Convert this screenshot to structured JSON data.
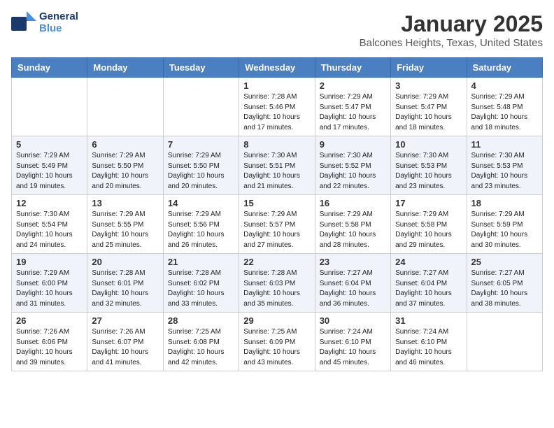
{
  "header": {
    "logo_general": "General",
    "logo_blue": "Blue",
    "month": "January 2025",
    "location": "Balcones Heights, Texas, United States"
  },
  "days_of_week": [
    "Sunday",
    "Monday",
    "Tuesday",
    "Wednesday",
    "Thursday",
    "Friday",
    "Saturday"
  ],
  "weeks": [
    [
      {
        "day": "",
        "info": ""
      },
      {
        "day": "",
        "info": ""
      },
      {
        "day": "",
        "info": ""
      },
      {
        "day": "1",
        "info": "Sunrise: 7:28 AM\nSunset: 5:46 PM\nDaylight: 10 hours\nand 17 minutes."
      },
      {
        "day": "2",
        "info": "Sunrise: 7:29 AM\nSunset: 5:47 PM\nDaylight: 10 hours\nand 17 minutes."
      },
      {
        "day": "3",
        "info": "Sunrise: 7:29 AM\nSunset: 5:47 PM\nDaylight: 10 hours\nand 18 minutes."
      },
      {
        "day": "4",
        "info": "Sunrise: 7:29 AM\nSunset: 5:48 PM\nDaylight: 10 hours\nand 18 minutes."
      }
    ],
    [
      {
        "day": "5",
        "info": "Sunrise: 7:29 AM\nSunset: 5:49 PM\nDaylight: 10 hours\nand 19 minutes."
      },
      {
        "day": "6",
        "info": "Sunrise: 7:29 AM\nSunset: 5:50 PM\nDaylight: 10 hours\nand 20 minutes."
      },
      {
        "day": "7",
        "info": "Sunrise: 7:29 AM\nSunset: 5:50 PM\nDaylight: 10 hours\nand 20 minutes."
      },
      {
        "day": "8",
        "info": "Sunrise: 7:30 AM\nSunset: 5:51 PM\nDaylight: 10 hours\nand 21 minutes."
      },
      {
        "day": "9",
        "info": "Sunrise: 7:30 AM\nSunset: 5:52 PM\nDaylight: 10 hours\nand 22 minutes."
      },
      {
        "day": "10",
        "info": "Sunrise: 7:30 AM\nSunset: 5:53 PM\nDaylight: 10 hours\nand 23 minutes."
      },
      {
        "day": "11",
        "info": "Sunrise: 7:30 AM\nSunset: 5:53 PM\nDaylight: 10 hours\nand 23 minutes."
      }
    ],
    [
      {
        "day": "12",
        "info": "Sunrise: 7:30 AM\nSunset: 5:54 PM\nDaylight: 10 hours\nand 24 minutes."
      },
      {
        "day": "13",
        "info": "Sunrise: 7:29 AM\nSunset: 5:55 PM\nDaylight: 10 hours\nand 25 minutes."
      },
      {
        "day": "14",
        "info": "Sunrise: 7:29 AM\nSunset: 5:56 PM\nDaylight: 10 hours\nand 26 minutes."
      },
      {
        "day": "15",
        "info": "Sunrise: 7:29 AM\nSunset: 5:57 PM\nDaylight: 10 hours\nand 27 minutes."
      },
      {
        "day": "16",
        "info": "Sunrise: 7:29 AM\nSunset: 5:58 PM\nDaylight: 10 hours\nand 28 minutes."
      },
      {
        "day": "17",
        "info": "Sunrise: 7:29 AM\nSunset: 5:58 PM\nDaylight: 10 hours\nand 29 minutes."
      },
      {
        "day": "18",
        "info": "Sunrise: 7:29 AM\nSunset: 5:59 PM\nDaylight: 10 hours\nand 30 minutes."
      }
    ],
    [
      {
        "day": "19",
        "info": "Sunrise: 7:29 AM\nSunset: 6:00 PM\nDaylight: 10 hours\nand 31 minutes."
      },
      {
        "day": "20",
        "info": "Sunrise: 7:28 AM\nSunset: 6:01 PM\nDaylight: 10 hours\nand 32 minutes."
      },
      {
        "day": "21",
        "info": "Sunrise: 7:28 AM\nSunset: 6:02 PM\nDaylight: 10 hours\nand 33 minutes."
      },
      {
        "day": "22",
        "info": "Sunrise: 7:28 AM\nSunset: 6:03 PM\nDaylight: 10 hours\nand 35 minutes."
      },
      {
        "day": "23",
        "info": "Sunrise: 7:27 AM\nSunset: 6:04 PM\nDaylight: 10 hours\nand 36 minutes."
      },
      {
        "day": "24",
        "info": "Sunrise: 7:27 AM\nSunset: 6:04 PM\nDaylight: 10 hours\nand 37 minutes."
      },
      {
        "day": "25",
        "info": "Sunrise: 7:27 AM\nSunset: 6:05 PM\nDaylight: 10 hours\nand 38 minutes."
      }
    ],
    [
      {
        "day": "26",
        "info": "Sunrise: 7:26 AM\nSunset: 6:06 PM\nDaylight: 10 hours\nand 39 minutes."
      },
      {
        "day": "27",
        "info": "Sunrise: 7:26 AM\nSunset: 6:07 PM\nDaylight: 10 hours\nand 41 minutes."
      },
      {
        "day": "28",
        "info": "Sunrise: 7:25 AM\nSunset: 6:08 PM\nDaylight: 10 hours\nand 42 minutes."
      },
      {
        "day": "29",
        "info": "Sunrise: 7:25 AM\nSunset: 6:09 PM\nDaylight: 10 hours\nand 43 minutes."
      },
      {
        "day": "30",
        "info": "Sunrise: 7:24 AM\nSunset: 6:10 PM\nDaylight: 10 hours\nand 45 minutes."
      },
      {
        "day": "31",
        "info": "Sunrise: 7:24 AM\nSunset: 6:10 PM\nDaylight: 10 hours\nand 46 minutes."
      },
      {
        "day": "",
        "info": ""
      }
    ]
  ]
}
